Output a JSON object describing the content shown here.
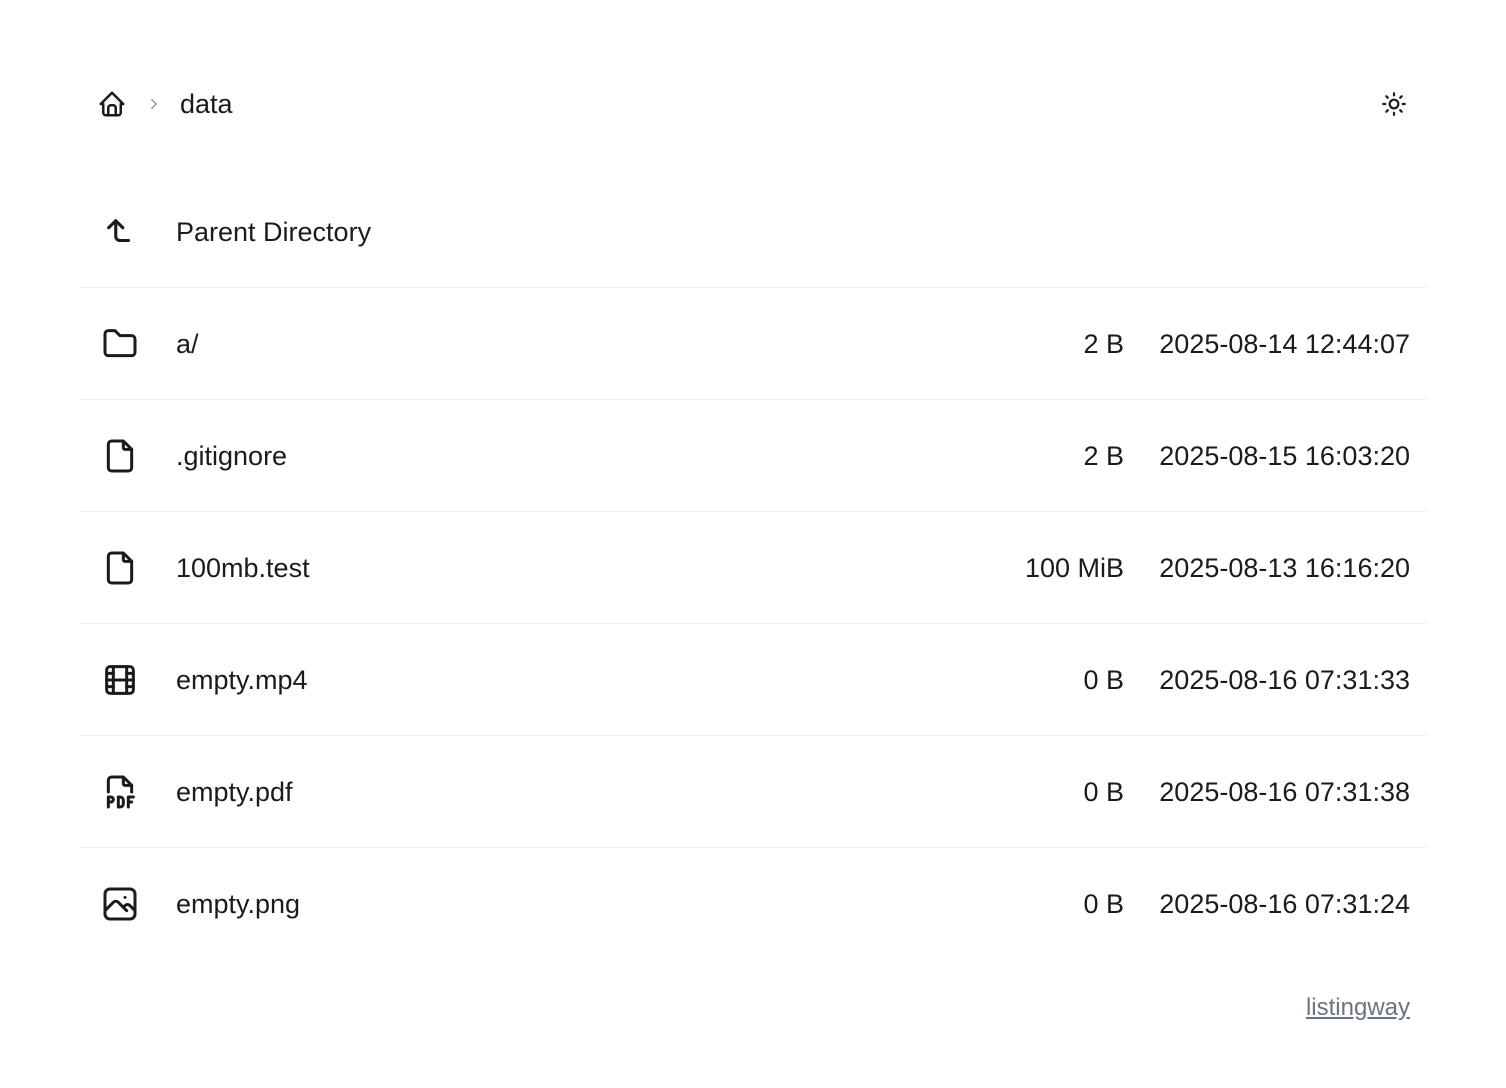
{
  "header": {
    "home_icon": "home-icon",
    "separator_icon": "chevron-right-icon",
    "current_folder": "data",
    "theme_icon": "sun-icon"
  },
  "listing": {
    "parent": {
      "icon": "corner-left-up-icon",
      "label": "Parent Directory"
    },
    "entries": [
      {
        "icon": "folder-icon",
        "name": "a/",
        "size": "2 B",
        "modified": "2025-08-14 12:44:07"
      },
      {
        "icon": "file-icon",
        "name": ".gitignore",
        "size": "2 B",
        "modified": "2025-08-15 16:03:20"
      },
      {
        "icon": "file-icon",
        "name": "100mb.test",
        "size": "100 MiB",
        "modified": "2025-08-13 16:16:20"
      },
      {
        "icon": "film-icon",
        "name": "empty.mp4",
        "size": "0 B",
        "modified": "2025-08-16 07:31:33"
      },
      {
        "icon": "file-pdf-icon",
        "name": "empty.pdf",
        "size": "0 B",
        "modified": "2025-08-16 07:31:38"
      },
      {
        "icon": "image-icon",
        "name": "empty.png",
        "size": "0 B",
        "modified": "2025-08-16 07:31:24"
      }
    ]
  },
  "footer": {
    "link_text": "listingway"
  },
  "colors": {
    "text": "#1b1b1b",
    "divider": "#ececec",
    "muted": "#6b7280",
    "background": "#ffffff"
  }
}
